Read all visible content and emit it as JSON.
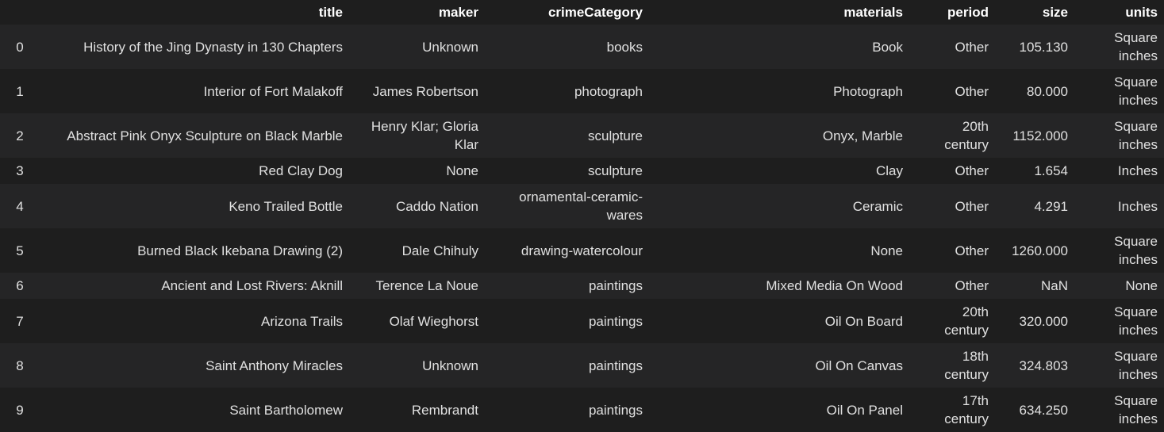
{
  "table": {
    "columns": [
      "",
      "title",
      "maker",
      "crimeCategory",
      "materials",
      "period",
      "size",
      "units"
    ],
    "rows": [
      {
        "index": "0",
        "title": "History of the Jing Dynasty in 130 Chapters",
        "maker": "Unknown",
        "crimeCategory": "books",
        "materials": "Book",
        "period": "Other",
        "size": "105.130",
        "units": "Square inches"
      },
      {
        "index": "1",
        "title": "Interior of Fort Malakoff",
        "maker": "James Robertson",
        "crimeCategory": "photograph",
        "materials": "Photograph",
        "period": "Other",
        "size": "80.000",
        "units": "Square inches"
      },
      {
        "index": "2",
        "title": "Abstract Pink Onyx Sculpture on Black Marble",
        "maker": "Henry Klar; Gloria Klar",
        "crimeCategory": "sculpture",
        "materials": "Onyx, Marble",
        "period": "20th century",
        "size": "1152.000",
        "units": "Square inches"
      },
      {
        "index": "3",
        "title": "Red Clay Dog",
        "maker": "None",
        "crimeCategory": "sculpture",
        "materials": "Clay",
        "period": "Other",
        "size": "1.654",
        "units": "Inches"
      },
      {
        "index": "4",
        "title": "Keno Trailed Bottle",
        "maker": "Caddo Nation",
        "crimeCategory": "ornamental-ceramic-wares",
        "materials": "Ceramic",
        "period": "Other",
        "size": "4.291",
        "units": "Inches"
      },
      {
        "index": "5",
        "title": "Burned Black Ikebana Drawing (2)",
        "maker": "Dale Chihuly",
        "crimeCategory": "drawing-watercolour",
        "materials": "None",
        "period": "Other",
        "size": "1260.000",
        "units": "Square inches"
      },
      {
        "index": "6",
        "title": "Ancient and Lost Rivers: Aknill",
        "maker": "Terence La Noue",
        "crimeCategory": "paintings",
        "materials": "Mixed Media On Wood",
        "period": "Other",
        "size": "NaN",
        "units": "None"
      },
      {
        "index": "7",
        "title": "Arizona Trails",
        "maker": "Olaf Wieghorst",
        "crimeCategory": "paintings",
        "materials": "Oil On Board",
        "period": "20th century",
        "size": "320.000",
        "units": "Square inches"
      },
      {
        "index": "8",
        "title": "Saint Anthony Miracles",
        "maker": "Unknown",
        "crimeCategory": "paintings",
        "materials": "Oil On Canvas",
        "period": "18th century",
        "size": "324.803",
        "units": "Square inches"
      },
      {
        "index": "9",
        "title": "Saint Bartholomew",
        "maker": "Rembrandt",
        "crimeCategory": "paintings",
        "materials": "Oil On Panel",
        "period": "17th century",
        "size": "634.250",
        "units": "Square inches"
      }
    ]
  },
  "colors": {
    "background": "#1e1e1e",
    "row_alt": "#252526",
    "header_text": "#ffffff",
    "cell_text": "#e0e0e0"
  }
}
